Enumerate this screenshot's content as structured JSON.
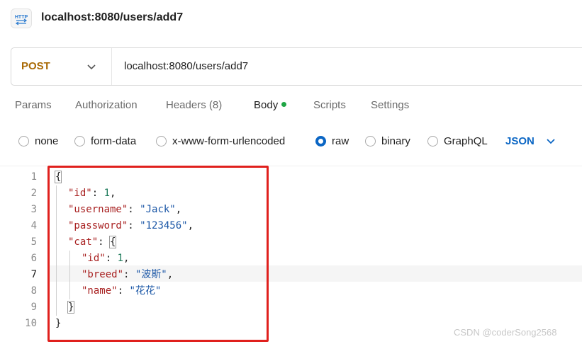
{
  "header": {
    "title": "localhost:8080/users/add7",
    "icon": "http-request-icon"
  },
  "request": {
    "method": "POST",
    "url": "localhost:8080/users/add7"
  },
  "tabs": [
    {
      "label": "Params"
    },
    {
      "label": "Authorization"
    },
    {
      "label": "Headers",
      "count": "(8)"
    },
    {
      "label": "Body",
      "active": true,
      "indicator_color": "#1fa645"
    },
    {
      "label": "Scripts"
    },
    {
      "label": "Settings"
    }
  ],
  "body_types": {
    "options": [
      "none",
      "form-data",
      "x-www-form-urlencoded",
      "raw",
      "binary",
      "GraphQL"
    ],
    "selected": "raw",
    "format": "JSON"
  },
  "editor": {
    "line_numbers": [
      "1",
      "2",
      "3",
      "4",
      "5",
      "6",
      "7",
      "8",
      "9",
      "10"
    ],
    "current_line": "7",
    "tokens": {
      "l1_open": "{",
      "l2_key": "\"id\"",
      "l2_sep": ": ",
      "l2_val": "1",
      "l2_end": ",",
      "l3_key": "\"username\"",
      "l3_sep": ": ",
      "l3_val": "\"Jack\"",
      "l3_end": ",",
      "l4_key": "\"password\"",
      "l4_sep": ": ",
      "l4_val": "\"123456\"",
      "l4_end": ",",
      "l5_key": "\"cat\"",
      "l5_sep": ": ",
      "l5_open": "{",
      "l6_key": "\"id\"",
      "l6_sep": ": ",
      "l6_val": "1",
      "l6_end": ",",
      "l7_key": "\"breed\"",
      "l7_sep": ": ",
      "l7_val": "\"波斯\"",
      "l7_end": ",",
      "l8_key": "\"name\"",
      "l8_sep": ": ",
      "l8_val": "\"花花\"",
      "l9_close": "}",
      "l10_close": "}"
    }
  },
  "colors": {
    "method": "#a96a06",
    "accent": "#0b66c4",
    "json_key": "#a82020",
    "json_string": "#1a56a6",
    "json_number": "#1d7a5a",
    "highlight_box": "#e0201d"
  },
  "watermark": "CSDN @coderSong2568"
}
